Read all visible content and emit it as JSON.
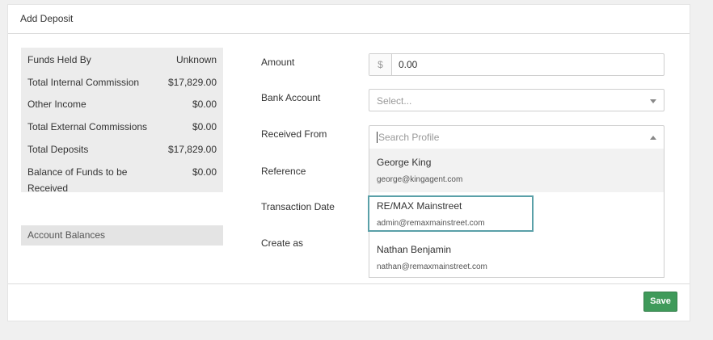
{
  "card": {
    "title": "Add Deposit"
  },
  "summary": {
    "rows": [
      {
        "label": "Funds Held By",
        "value": "Unknown"
      },
      {
        "label": "Total Internal Commission",
        "value": "$17,829.00"
      },
      {
        "label": "Other Income",
        "value": "$0.00"
      },
      {
        "label": "Total External Commissions",
        "value": "$0.00"
      },
      {
        "label": "Total Deposits",
        "value": "$17,829.00"
      },
      {
        "label": "Balance of Funds to be Received",
        "value": "$0.00"
      }
    ],
    "account_balances_label": "Account Balances"
  },
  "form": {
    "amount_label": "Amount",
    "currency_symbol": "$",
    "amount_value": "0.00",
    "bank_account_label": "Bank Account",
    "bank_account_placeholder": "Select...",
    "received_from_label": "Received From",
    "received_from_placeholder": "Search Profile",
    "reference_label": "Reference",
    "transaction_date_label": "Transaction Date",
    "create_as_label": "Create as"
  },
  "dropdown": {
    "options": [
      {
        "name": "George King",
        "email": "george@kingagent.com"
      },
      {
        "name": "RE/MAX Mainstreet",
        "email": "admin@remaxmainstreet.com"
      },
      {
        "name": "Nathan Benjamin",
        "email": "nathan@remaxmainstreet.com"
      }
    ]
  },
  "footer": {
    "save_label": "Save"
  },
  "colors": {
    "save": "#3f9a5a",
    "highlight": "#5aa0a8"
  }
}
